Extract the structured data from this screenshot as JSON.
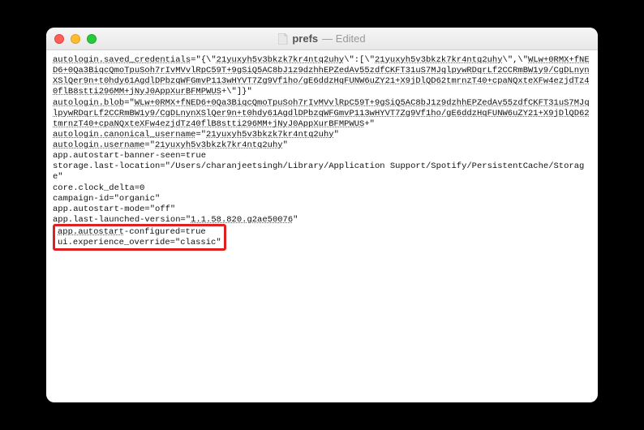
{
  "window": {
    "title": "prefs",
    "status": "— Edited"
  },
  "lines": {
    "l0a": "autologin.saved_credentials",
    "l0b": "=\"{\\\"",
    "l0c": "21yuxyh5v3bkzk7kr4ntq2uhy",
    "l0d": "\\\":[\\\"",
    "l0e": "21yuxyh5v3bkzk7kr4ntq2uhy",
    "l0f": "\\\",\\\"",
    "l0g": "WLw+0RMX+fNED6+0Qa3BiqcQmoTpuSoh7rIvMVvlRpC59T+9gSiQ5AC8bJ1z9dzhhEPZedAv55zdfCKFT31uS7MJqlpywRDqrLf2CCRmBW1y9/CgDLnynXSlQer9n+t0hdy61AgdlDPbzqWFGmvP113wHYVT7Zg9Vf1ho/gE6ddzHqFUNW6uZY21+X9jDlQD62tmrnzT40+cpaNQxteXFw4ezjdTz40flB8stti296MM+jNyJ0AppXurBFMPWUS",
    "l0h": "+\\\"]}\"",
    "l1a": "autologin.blob",
    "l1b": "=\"",
    "l1c": "WLw+0RMX+fNED6+0Qa3BiqcQmoTpuSoh7rIvMVvlRpC59T+9gSiQ5AC8bJ1z9dzhhEPZedAv55zdfCKFT31uS7MJqlpywRDqrLf2CCRmBW1y9/CgDLnynXSlQer9n+t0hdy61AgdlDPbzqWFGmvP113wHYVT7Zg9Vf1ho/gE6ddzHqFUNW6uZY21+X9jDlQD62tmrnzT40+cpaNQxteXFw4ezjdTz40flB8stti296MM+jNyJ0AppXurBFMPWUS",
    "l1d": "+\"",
    "l2a": "autologin.canonical_username",
    "l2b": "=\"",
    "l2c": "21yuxyh5v3bkzk7kr4ntq2uhy",
    "l2d": "\"",
    "l3a": "autologin.username",
    "l3b": "=\"",
    "l3c": "21yuxyh5v3bkzk7kr4ntq2uhy",
    "l3d": "\"",
    "l4": "app.autostart-banner-seen=true",
    "l5": "storage.last-location=\"/Users/charanjeetsingh/Library/Application Support/Spotify/PersistentCache/Storage\"",
    "l6": "core.clock_delta=0",
    "l7": "campaign-id=\"organic\"",
    "l8": "app.autostart-mode=\"off\"",
    "l9a": "app.last-launched-version=\"",
    "l9b": "1.1.58.820.g2ae50076",
    "l9c": "\"",
    "l10a": "app.autostart",
    "l10b": "-configured=true",
    "l11": "ui.experience_override=\"classic\""
  }
}
